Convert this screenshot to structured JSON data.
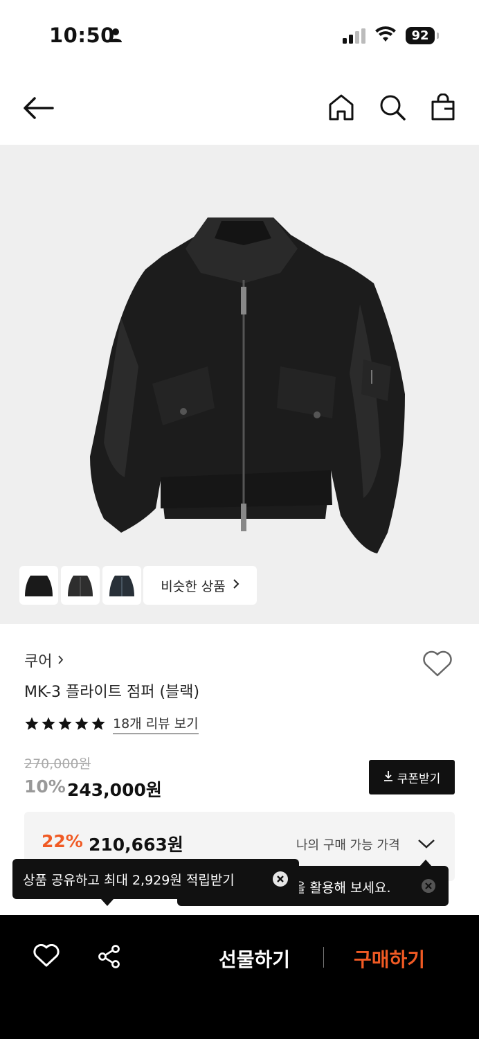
{
  "status_bar": {
    "time": "10:50",
    "battery": "92"
  },
  "nav": {
    "icons": [
      "back-arrow-icon",
      "home-icon",
      "search-icon",
      "shopping-bag-icon"
    ]
  },
  "image": {
    "similar_label": "비슷한 상품"
  },
  "product": {
    "brand": "쿠어",
    "name": "MK-3 플라이트 점퍼 (블랙)",
    "rating_stars": 5,
    "review_link": "18개 리뷰 보기",
    "original_price": "270,000원",
    "discount": "10%",
    "price": "243,000원",
    "coupon_label": "쿠폰받기"
  },
  "best_price": {
    "discount": "22%",
    "price": "210,663원",
    "label": "나의 구매 가능 가격"
  },
  "tooltips": {
    "share": "상품 공유하고 최대 2,929원 적립받기",
    "benefit_partial": "을 활용해 보세요."
  },
  "bottom_bar": {
    "gift_label": "선물하기",
    "buy_label": "구매하기"
  },
  "colors": {
    "accent": "#f05a24",
    "bar": "#000000",
    "image_bg": "#efefef"
  }
}
